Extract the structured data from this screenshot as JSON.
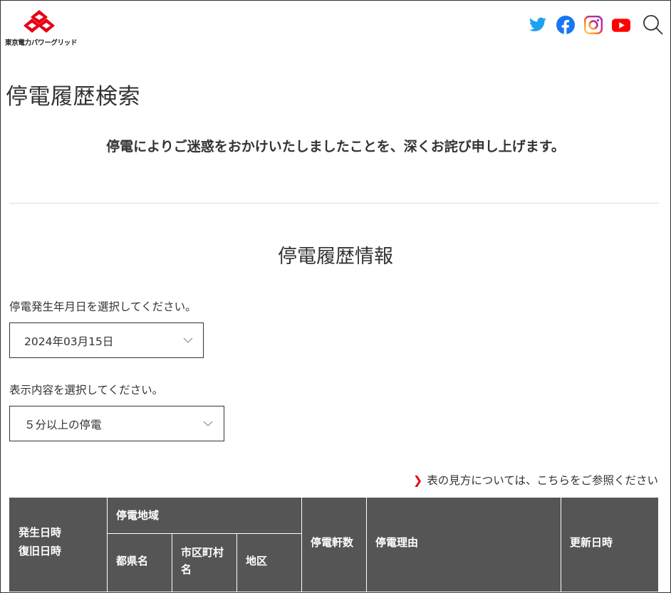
{
  "header": {
    "logo_text": "東京電力パワーグリッド",
    "sns": [
      {
        "name": "twitter",
        "color": "#1da1f2"
      },
      {
        "name": "facebook",
        "color": "#1877f2"
      },
      {
        "name": "instagram",
        "color": "#c13584"
      },
      {
        "name": "youtube",
        "color": "#ff0000"
      }
    ],
    "brand_color": "#e60012"
  },
  "page": {
    "title": "停電履歴検索",
    "apology": "停電によりご迷惑をおかけいたしましたことを、深くお詫び申し上げます。",
    "section_title": "停電履歴情報"
  },
  "form": {
    "date_label": "停電発生年月日を選択してください。",
    "date_value": "2024年03月15日",
    "type_label": "表示内容を選択してください。",
    "type_value": "５分以上の停電"
  },
  "guide_link": "表の見方については、こちらをご参照ください",
  "table": {
    "header_bg": "#555555",
    "col_occurred": "発生日時",
    "col_restored": "復旧日時",
    "col_area": "停電地域",
    "col_prefecture": "都県名",
    "col_city_1": "市区町村",
    "col_city_2": "名",
    "col_district": "地区",
    "col_count": "停電軒数",
    "col_reason": "停電理由",
    "col_updated": "更新日時"
  }
}
